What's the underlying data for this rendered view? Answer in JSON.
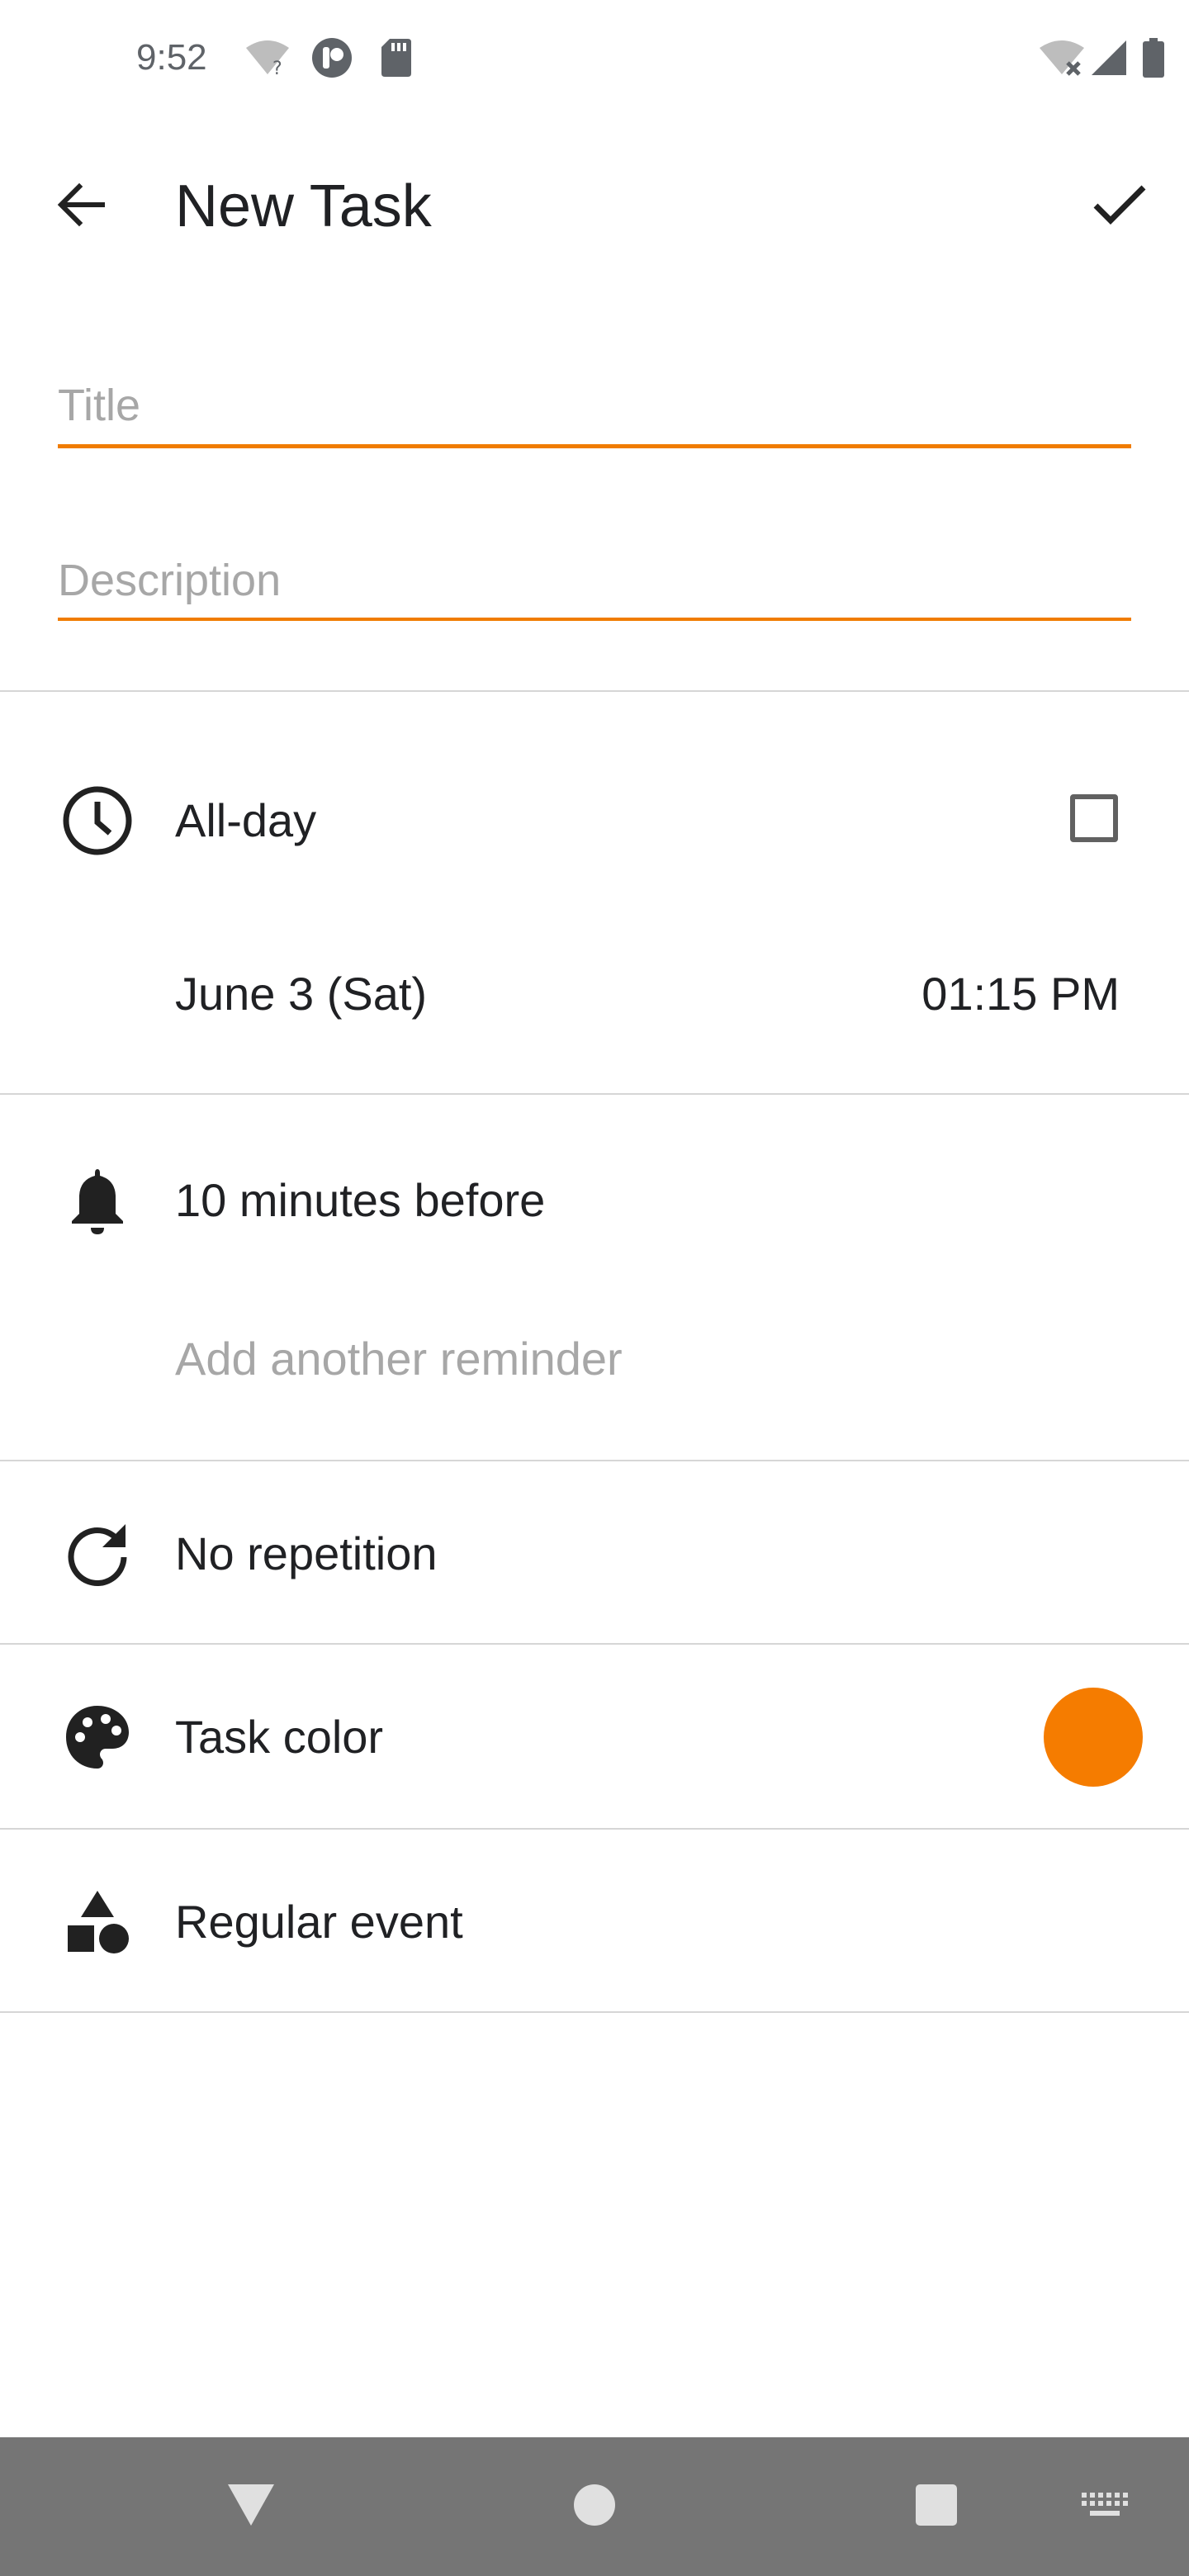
{
  "status_bar": {
    "time": "9:52",
    "left_icons": [
      "wifi-question-icon",
      "pie-app-icon",
      "sd-card-icon"
    ],
    "right_icons": [
      "wifi-off-icon",
      "cell-signal-icon",
      "battery-icon"
    ]
  },
  "app_bar": {
    "back_icon": "arrow-left-icon",
    "title": "New Task",
    "confirm_icon": "check-icon"
  },
  "form": {
    "title_placeholder": "Title",
    "title_value": "",
    "description_placeholder": "Description",
    "description_value": ""
  },
  "schedule": {
    "icon": "clock-icon",
    "all_day_label": "All-day",
    "all_day_checked": false,
    "date": "June 3 (Sat)",
    "time": "01:15 PM"
  },
  "reminders": {
    "icon": "bell-icon",
    "items": [
      "10 minutes before"
    ],
    "add_label": "Add another reminder"
  },
  "repetition": {
    "icon": "repeat-icon",
    "label": "No repetition"
  },
  "task_color": {
    "icon": "palette-icon",
    "label": "Task color",
    "value": "#f57c00"
  },
  "event_type": {
    "icon": "shapes-icon",
    "label": "Regular event"
  },
  "nav_bar": {
    "buttons": [
      "back-triangle-icon",
      "home-circle-icon",
      "recents-square-icon",
      "keyboard-icon"
    ]
  },
  "colors": {
    "accent": "#f07c00",
    "divider": "#d6d6d6",
    "nav_bar": "#757575"
  }
}
